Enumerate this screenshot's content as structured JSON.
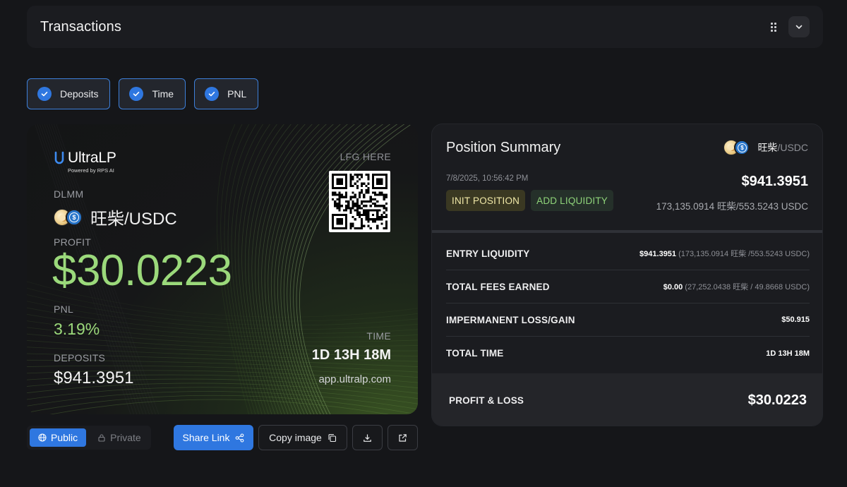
{
  "header": {
    "title": "Transactions"
  },
  "filters": [
    {
      "label": "Deposits",
      "checked": true
    },
    {
      "label": "Time",
      "checked": true
    },
    {
      "label": "PNL",
      "checked": true
    }
  ],
  "card": {
    "brand": "UltraLP",
    "brand_sub": "Powered by RPS AI",
    "type_label": "DLMM",
    "pair": "旺柴/USDC",
    "profit_label": "PROFIT",
    "profit_value": "$30.0223",
    "pnl_label": "PNL",
    "pnl_value": "3.19%",
    "deposits_label": "DEPOSITS",
    "deposits_value": "$941.3951",
    "qr_label": "LFG HERE",
    "time_label": "TIME",
    "time_value": "1D 13H 18M",
    "url": "app.ultralp.com",
    "colors": {
      "accent_green": "#9bd97b",
      "accent_blue": "#2f77e0"
    }
  },
  "toolbar": {
    "public_label": "Public",
    "private_label": "Private",
    "share_label": "Share Link",
    "copy_label": "Copy image"
  },
  "summary": {
    "title": "Position Summary",
    "pair_base": "旺柴",
    "pair_quote": "/USDC",
    "date": "7/8/2025, 10:56:42 PM",
    "tag_init": "INIT POSITION",
    "tag_add": "ADD LIQUIDITY",
    "amount": "$941.3951",
    "amount_sub": "173,135.0914 旺柴/553.5243 USDC",
    "rows": [
      {
        "label": "ENTRY LIQUIDITY",
        "value": "$941.3951",
        "detail": " (173,135.0914 旺柴 /553.5243 USDC)"
      },
      {
        "label": "TOTAL FEES EARNED",
        "value": "$0.00",
        "detail": " (27,252.0438 旺柴 / 49.8668 USDC)"
      },
      {
        "label": "IMPERMANENT LOSS/GAIN",
        "value": "$50.915",
        "detail": ""
      },
      {
        "label": "TOTAL TIME",
        "value": "1D 13H 18M",
        "detail": ""
      }
    ],
    "footer_label": "PROFIT & LOSS",
    "footer_value": "$30.0223"
  }
}
